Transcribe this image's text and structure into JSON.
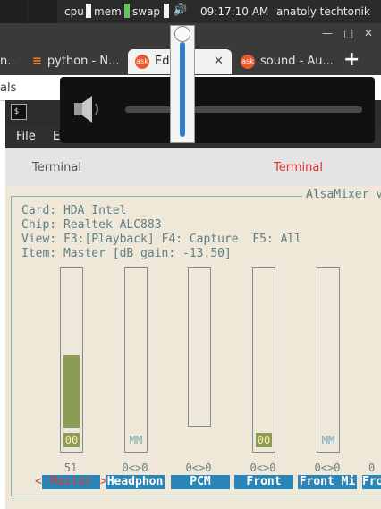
{
  "topbar": {
    "cpu": "cpu",
    "mem": "mem",
    "swap": "swap",
    "time": "09:17:10 AM",
    "user": "anatoly techtonik"
  },
  "browser": {
    "tabs": [
      {
        "label": "n..."
      },
      {
        "label": "python - N..."
      },
      {
        "label": "Ed",
        "favicon": "ask",
        "active": true
      },
      {
        "label": "sound - Au...",
        "favicon": "ask"
      }
    ],
    "new_tab": "+",
    "address_text": "als"
  },
  "terminal": {
    "menu": {
      "file": "File",
      "edit": "E"
    },
    "tabs": [
      {
        "label": "Terminal",
        "active": false
      },
      {
        "label": "Terminal",
        "active": true
      }
    ],
    "alsamixer": {
      "title": "AlsaMixer v",
      "info": [
        "Card: HDA Intel",
        "Chip: Realtek ALC883",
        "View: F3:[Playback] F4: Capture  F5: All",
        "Item: Master [dB gain: -13.50]"
      ],
      "channels": [
        {
          "name": "Master",
          "value": "51",
          "state": "00",
          "level": 0.51,
          "selected": true,
          "left_marker": "<",
          "right_marker": ">"
        },
        {
          "name": "Headphon",
          "value": "0<>0",
          "state": "MM",
          "level": 0
        },
        {
          "name": "PCM",
          "value": "0<>0",
          "state": "",
          "level": 0
        },
        {
          "name": "Front",
          "value": "0<>0",
          "state": "00",
          "level": 0
        },
        {
          "name": "Front Mi",
          "value": "0<>0",
          "state": "MM",
          "level": 0
        },
        {
          "name": "Fro",
          "value": "0",
          "state": "",
          "level": 0
        }
      ]
    }
  },
  "volume": {
    "level": 0.95
  },
  "colors": {
    "accent": "#2a86b8",
    "active_tab_text": "#e03030",
    "meter_fill": "#8d9c55",
    "terminal_bg": "#efe8d8"
  }
}
